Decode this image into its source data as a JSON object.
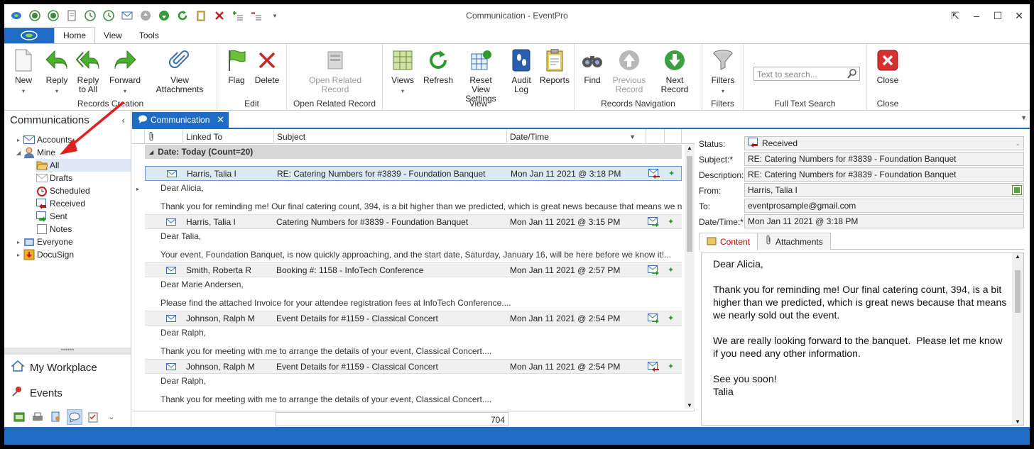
{
  "window": {
    "title": "Communication - EventPro"
  },
  "ribbon_tabs": [
    "Home",
    "View",
    "Tools"
  ],
  "ribbon": {
    "new": "New",
    "reply": "Reply",
    "reply_all_1": "Reply",
    "reply_all_2": "to All",
    "forward": "Forward",
    "view_attachments": "View Attachments",
    "group_records_creation": "Records Creation",
    "flag": "Flag",
    "delete": "Delete",
    "group_edit": "Edit",
    "open_related_1": "Open Related",
    "open_related_2": "Record",
    "group_open_related": "Open Related Record",
    "views": "Views",
    "refresh": "Refresh",
    "reset_1": "Reset View",
    "reset_2": "Settings",
    "audit_1": "Audit",
    "audit_2": "Log",
    "reports": "Reports",
    "group_view": "View",
    "find": "Find",
    "prev_1": "Previous",
    "prev_2": "Record",
    "next_record": "Next Record",
    "group_nav": "Records Navigation",
    "filters": "Filters",
    "group_filters": "Filters",
    "search_placeholder": "Text to search...",
    "group_search": "Full Text Search",
    "close": "Close",
    "group_close": "Close"
  },
  "nav": {
    "header": "Communications",
    "tree": [
      "Accounts",
      "Mine",
      "All",
      "Drafts",
      "Scheduled",
      "Received",
      "Sent",
      "Notes",
      "Everyone",
      "DocuSign"
    ],
    "my_workplace": "My Workplace",
    "events": "Events"
  },
  "doctab": "Communication",
  "grid": {
    "headers": {
      "linked": "Linked To",
      "subject": "Subject",
      "date": "Date/Time"
    },
    "group": "Date: Today (Count=20)",
    "rows": [
      {
        "linked": "Harris, Talia I",
        "subject": "RE: Catering Numbers for #3839 - Foundation Banquet",
        "date": "Mon Jan 11 2021 @ 3:18 PM",
        "dir": "in",
        "p1": "Dear Alicia,",
        "p2": "Thank you for reminding me! Our final catering count, 394, is a bit higher than we predicted, which is great news because that means we nearly sold o..."
      },
      {
        "linked": "Harris, Talia I",
        "subject": "Catering Numbers for #3839 - Foundation Banquet",
        "date": "Mon Jan 11 2021 @ 3:15 PM",
        "dir": "out",
        "p1": "Dear Talia,",
        "p2": "Your event, Foundation Banquet, is now quickly approaching, and the start date, Saturday, January 16, will be here before we know it!..."
      },
      {
        "linked": "Smith, Roberta R",
        "subject": "Booking #: 1158 - InfoTech Conference",
        "date": "Mon Jan 11 2021 @ 2:57 PM",
        "dir": "out",
        "p1": "Dear Marie Andersen,",
        "p2": "Please find the attached Invoice for your attendee registration fees at InfoTech Conference...."
      },
      {
        "linked": "Johnson, Ralph M",
        "subject": "Event Details for #1159 - Classical Concert",
        "date": "Mon Jan 11 2021 @ 2:54 PM",
        "dir": "out",
        "p1": "Dear Ralph,",
        "p2": "Thank you for meeting with me to arrange the details of your event, Classical Concert...."
      },
      {
        "linked": "Johnson, Ralph M",
        "subject": "Event Details for #1159 - Classical Concert",
        "date": "Mon Jan 11 2021 @ 2:54 PM",
        "dir": "in",
        "p1": "Dear Ralph,",
        "p2": "Thank you for meeting with me to arrange the details of your event, Classical Concert...."
      }
    ],
    "footer_value": "704"
  },
  "detail": {
    "status_label": "Status:",
    "status": "Received",
    "subject_label": "Subject:*",
    "subject": "RE: Catering Numbers for #3839 - Foundation Banquet",
    "description_label": "Description:",
    "description": "RE: Catering Numbers for #3839 - Foundation Banquet",
    "from_label": "From:",
    "from": "Harris, Talia I",
    "to_label": "To:",
    "to": "eventprosample@gmail.com",
    "datetime_label": "Date/Time:*",
    "datetime": "Mon Jan 11 2021 @ 3:18 PM",
    "tab_content": "Content",
    "tab_attachments": "Attachments",
    "body": "Dear Alicia,\n\nThank you for reminding me! Our final catering count, 394, is a bit higher than we predicted, which is great news because that means we nearly sold out the event.\n\nWe are really looking forward to the banquet.  Please let me know if you need any other information.\n\nSee you soon!\nTalia"
  },
  "colors": {
    "accent": "#1f6cc4",
    "annotation_arrow": "#e02020"
  }
}
